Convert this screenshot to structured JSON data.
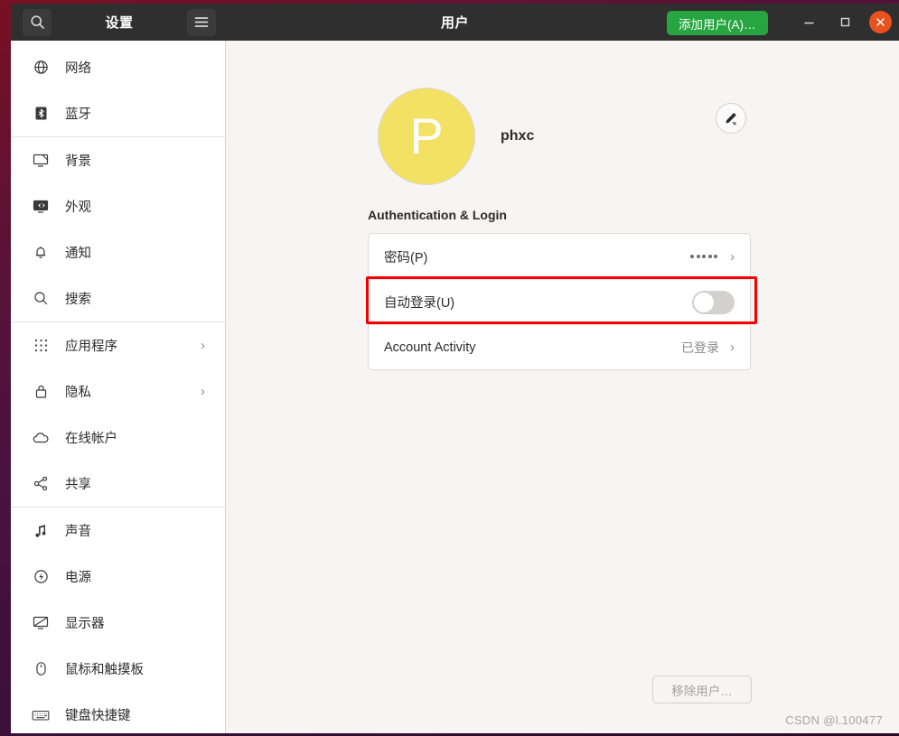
{
  "titlebar": {
    "settings_title": "设置",
    "page_title": "用户",
    "add_user_label": "添加用户(A)…",
    "search_icon": "search-icon",
    "menu_icon": "hamburger-menu-icon",
    "minimize_icon": "minimize-icon",
    "maximize_icon": "maximize-icon",
    "close_icon": "close-icon",
    "accent_green": "#26a541",
    "close_orange": "#e8521f"
  },
  "sidebar": {
    "groups": [
      {
        "items": [
          {
            "label": "网络",
            "icon": "globe-icon",
            "chevron": ""
          },
          {
            "label": "蓝牙",
            "icon": "bluetooth-icon",
            "chevron": ""
          }
        ]
      },
      {
        "items": [
          {
            "label": "背景",
            "icon": "wallpaper-icon",
            "chevron": ""
          },
          {
            "label": "外观",
            "icon": "appearance-icon",
            "chevron": ""
          },
          {
            "label": "通知",
            "icon": "bell-icon",
            "chevron": ""
          },
          {
            "label": "搜索",
            "icon": "search-icon",
            "chevron": ""
          }
        ]
      },
      {
        "items": [
          {
            "label": "应用程序",
            "icon": "apps-grid-icon",
            "chevron": "›"
          },
          {
            "label": "隐私",
            "icon": "lock-icon",
            "chevron": "›"
          },
          {
            "label": "在线帐户",
            "icon": "cloud-icon",
            "chevron": ""
          },
          {
            "label": "共享",
            "icon": "share-icon",
            "chevron": ""
          }
        ]
      },
      {
        "items": [
          {
            "label": "声音",
            "icon": "music-note-icon",
            "chevron": ""
          },
          {
            "label": "电源",
            "icon": "power-icon",
            "chevron": ""
          },
          {
            "label": "显示器",
            "icon": "display-icon",
            "chevron": ""
          },
          {
            "label": "鼠标和触摸板",
            "icon": "mouse-icon",
            "chevron": ""
          },
          {
            "label": "键盘快捷键",
            "icon": "keyboard-icon",
            "chevron": ""
          }
        ]
      }
    ]
  },
  "user": {
    "avatar_initial": "P",
    "avatar_color": "#f2e162",
    "username": "phxc",
    "edit_icon": "pencil-edit-icon"
  },
  "main": {
    "section_title": "Authentication & Login",
    "rows": [
      {
        "label": "密码(P)",
        "value": "",
        "kind": "password",
        "chevron": "›"
      },
      {
        "label": "自动登录(U)",
        "value": "",
        "kind": "toggle",
        "toggle_on": false,
        "chevron": ""
      },
      {
        "label": "Account Activity",
        "value": "已登录",
        "kind": "link",
        "chevron": "›"
      }
    ],
    "highlight_color": "#f50000",
    "remove_user_label": "移除用户…"
  },
  "watermark": "CSDN @l.100477"
}
